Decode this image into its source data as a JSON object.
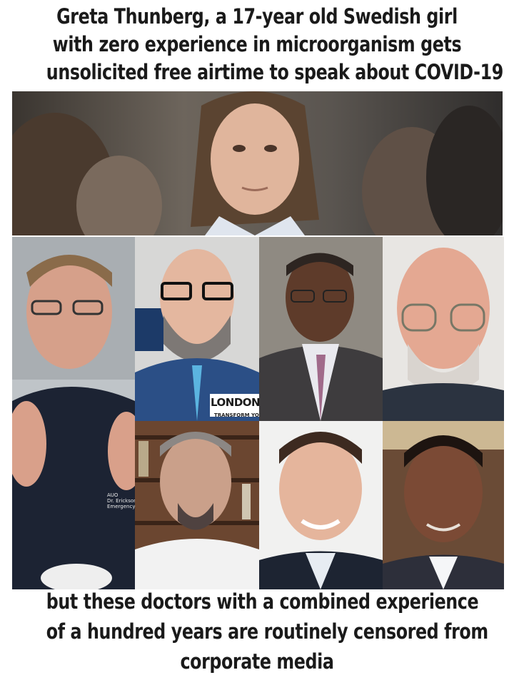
{
  "top_caption": {
    "line1": "Greta Thunberg, a 17-year old Swedish girl",
    "line2": "with zero experience in microorganism gets",
    "line3": "unsolicited free airtime to speak about COVID-19"
  },
  "bottom_caption": {
    "line1": "but these doctors with a combined experience",
    "line2": "of a hundred years are routinely censored from",
    "line3": "corporate media"
  },
  "overlays": {
    "london": "LONDON",
    "london_sub": "TRANSFORM YO",
    "scrub": "AUO\nDr. Erickson\nEmergency Ph"
  },
  "colors": {
    "text": "#1a1a1a",
    "background": "#ffffff"
  }
}
